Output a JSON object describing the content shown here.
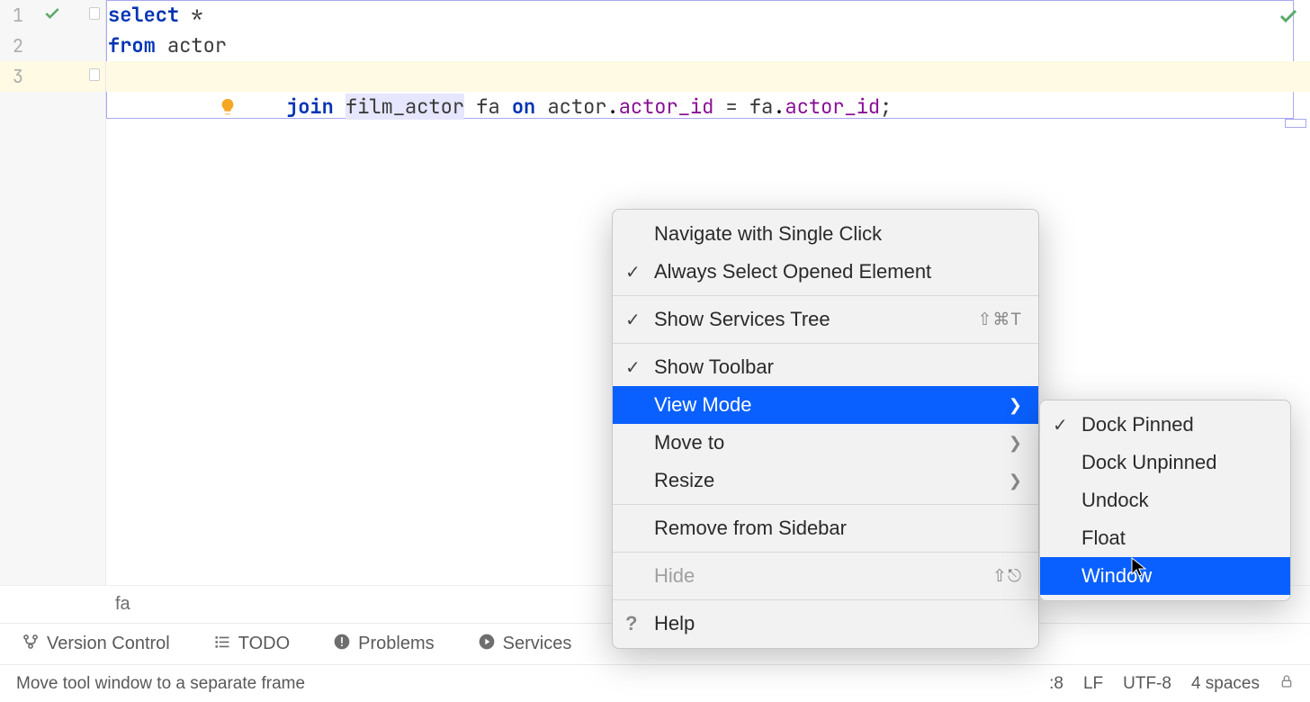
{
  "editor": {
    "lines": [
      {
        "number": "1",
        "check": true
      },
      {
        "number": "2"
      },
      {
        "number": "3",
        "highlighted": true
      }
    ],
    "code": {
      "line1": {
        "select": "select",
        "star": " *"
      },
      "line2": {
        "from": "from",
        "actor": " actor"
      },
      "line3": {
        "indent": "         ",
        "join": "join",
        "sp1": " ",
        "film_actor": "film_actor",
        "sp2": " ",
        "fa": "fa",
        "sp3": " ",
        "on": "on",
        "sp4": " ",
        "actor2": "actor",
        "dot1": ".",
        "actor_id1": "actor_id",
        "eq": " = ",
        "fa2": "fa",
        "dot2": ".",
        "actor_id2": "actor_id",
        "semi": ";"
      }
    }
  },
  "breadcrumb": {
    "label": "fa"
  },
  "tool_windows": {
    "version_control": "Version Control",
    "todo": "TODO",
    "problems": "Problems",
    "services": "Services"
  },
  "context_menu": {
    "navigate_single_click": "Navigate with Single Click",
    "always_select_opened": "Always Select Opened Element",
    "show_services_tree": "Show Services Tree",
    "services_tree_shortcut": "⇧⌘T",
    "show_toolbar": "Show Toolbar",
    "view_mode": "View Mode",
    "move_to": "Move to",
    "resize": "Resize",
    "remove_sidebar": "Remove from Sidebar",
    "hide": "Hide",
    "hide_shortcut": "⇧⎋",
    "help": "Help"
  },
  "view_mode_submenu": {
    "dock_pinned": "Dock Pinned",
    "dock_unpinned": "Dock Unpinned",
    "undock": "Undock",
    "float": "Float",
    "window": "Window"
  },
  "status_bar": {
    "hint": "Move tool window to a separate frame",
    "pos": ":8",
    "line_sep": "LF",
    "encoding": "UTF-8",
    "indent": "4 spaces"
  }
}
